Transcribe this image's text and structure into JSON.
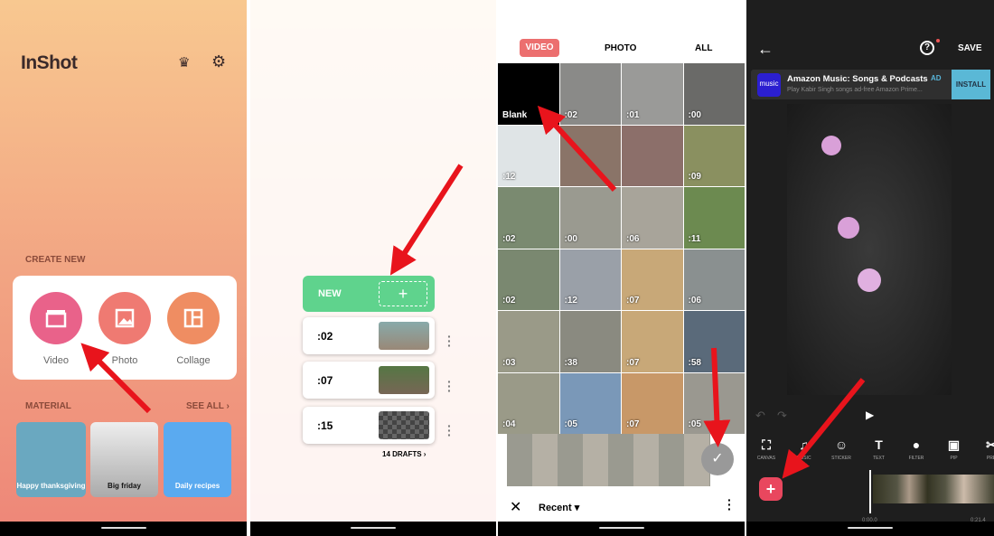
{
  "home": {
    "logo": "InShot",
    "create_new": "CREATE NEW",
    "create_items": [
      {
        "label": "Video",
        "icon": "clapperboard-icon",
        "color": "#e9628a"
      },
      {
        "label": "Photo",
        "icon": "image-icon",
        "color": "#ef7a72"
      },
      {
        "label": "Collage",
        "icon": "collage-icon",
        "color": "#ef8d62"
      }
    ],
    "material": "MATERIAL",
    "see_all": "SEE ALL",
    "tiles": [
      {
        "label": "Happy thanksgiving",
        "color": "#6aa8c0"
      },
      {
        "label": "Big friday",
        "color": "#cfcfcf"
      },
      {
        "label": "Daily recipes",
        "color": "#5aaaf0"
      }
    ]
  },
  "drafts": {
    "new_label": "NEW",
    "items": [
      {
        "duration": ":02"
      },
      {
        "duration": ":07"
      },
      {
        "duration": ":15"
      }
    ],
    "count_label": "14 DRAFTS",
    "accent": "#5fd38d"
  },
  "picker": {
    "tabs": [
      "VIDEO",
      "PHOTO",
      "ALL"
    ],
    "active_tab": "VIDEO",
    "accent": "#ec6f6f",
    "items": [
      "Blank",
      ":02",
      ":01",
      ":00",
      ":12",
      "",
      "",
      ":09",
      ":02",
      ":00",
      ":06",
      ":11",
      ":02",
      ":12",
      ":07",
      ":06",
      ":03",
      ":38",
      ":07",
      ":58",
      ":04",
      ":05",
      ":07",
      ":05"
    ],
    "album": "Recent"
  },
  "editor": {
    "save": "SAVE",
    "ad": {
      "badge": "music",
      "title": "Amazon Music: Songs & Podcasts",
      "tag": "AD",
      "subtitle": "Play Kabir Singh songs ad-free Amazon Prime...",
      "install": "INSTALL"
    },
    "tools": [
      {
        "label": "CANVAS",
        "glyph": "⛶"
      },
      {
        "label": "MUSIC",
        "glyph": "♫"
      },
      {
        "label": "STICKER",
        "glyph": "☺"
      },
      {
        "label": "TEXT",
        "glyph": "T"
      },
      {
        "label": "FILTER",
        "glyph": "●"
      },
      {
        "label": "PIP",
        "glyph": "▣"
      },
      {
        "label": "PRE",
        "glyph": "✂"
      }
    ],
    "time_start": "0:00.0",
    "time_end": "0:21.4",
    "add_color": "#e9475e"
  }
}
